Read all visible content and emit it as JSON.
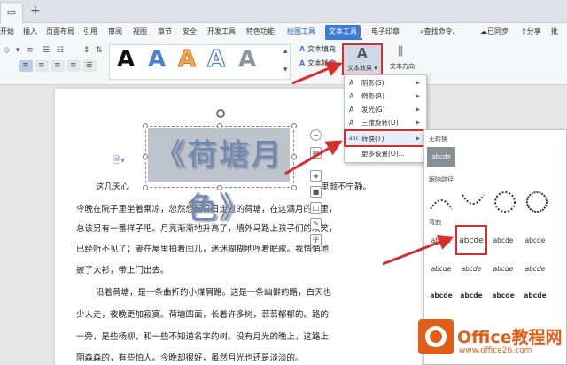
{
  "colors": {
    "accent": "#3a7bd5",
    "highlight": "#d62d2d",
    "wordart": "#6d87b6",
    "watermark": "#e25d17"
  },
  "tabbar": {
    "new_tab": "+"
  },
  "ribbon": {
    "tabs": [
      "开始",
      "插入",
      "页面布局",
      "引用",
      "审阅",
      "视图",
      "章节",
      "安全",
      "开发工具",
      "特色功能",
      "绘图工具",
      "文本工具",
      "电子印章"
    ],
    "search": "查找命令、",
    "sync": "已同步",
    "share": "分享",
    "batch": "批"
  },
  "toolbar": {
    "text_fill": "文本填充",
    "text_outline": "文本轮廓",
    "text_effect": "文本效果",
    "text_direction": "文本方向",
    "styles": [
      "A",
      "A",
      "A",
      "A",
      "A"
    ]
  },
  "document": {
    "wordart": "《荷塘月色》",
    "lines": [
      "这几天心",
      "今晚在院子里坐着乘凉，忽然想起日日走过的荷塘，在这满月的光里，",
      "总该另有一番样子吧。月亮渐渐地升高了，墙外马路上孩子们的欢笑，",
      "已经听不见了；妻在屋里拍着闰儿，迷迷糊糊地哼着眠歌。我悄悄地",
      "披了大衫，带上门出去。",
      "沿着荷塘，是一条曲折的小煤屑路。这是一条幽僻的路，白天也",
      "少人走，夜晚更加寂寞。荷塘四面，长着许多树，蓊蓊郁郁的。路的",
      "一旁，是些杨柳，和一些不知道名字的树。没有月光的晚上，这路上",
      "阴森森的，有些怕人。今晚却很好，虽然月光也还是淡淡的。"
    ],
    "line_tail": "里颇不宁静。"
  },
  "menu": {
    "items": [
      {
        "label": "阴影(S)",
        "icon": "A"
      },
      {
        "label": "倒影(R)",
        "icon": "A"
      },
      {
        "label": "发光(G)",
        "icon": "A"
      },
      {
        "label": "三维旋转(D)",
        "icon": "A"
      },
      {
        "label": "转换(T)",
        "icon": "abc"
      },
      {
        "label": "更多设置(O)...",
        "icon": ""
      }
    ]
  },
  "gallery": {
    "no_transform_title": "无转换",
    "no_transform_item": "abcde",
    "path_title": "跟随路径",
    "warp_title": "弯曲",
    "cell_text": "abcde"
  },
  "watermark": {
    "title": "Office教程网",
    "sub": "www.office26.com"
  }
}
